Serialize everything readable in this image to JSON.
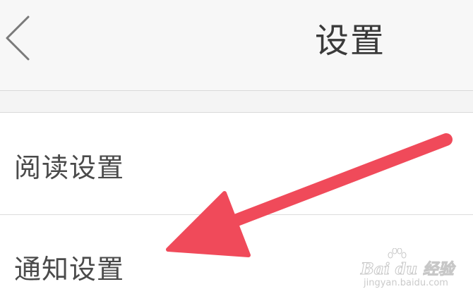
{
  "header": {
    "title": "设置",
    "back_icon": "chevron-left-icon"
  },
  "settings": {
    "items": [
      {
        "label": "阅读设置"
      },
      {
        "label": "通知设置"
      }
    ]
  },
  "annotation": {
    "arrow_color": "#f04a5a"
  },
  "watermark": {
    "brand": "Bai du 经验",
    "url": "jingyan.baidu.com"
  },
  "colors": {
    "background": "#f7f7f7",
    "list_background": "#ffffff",
    "divider": "#d9d9d9",
    "text": "#4a4a4a"
  }
}
